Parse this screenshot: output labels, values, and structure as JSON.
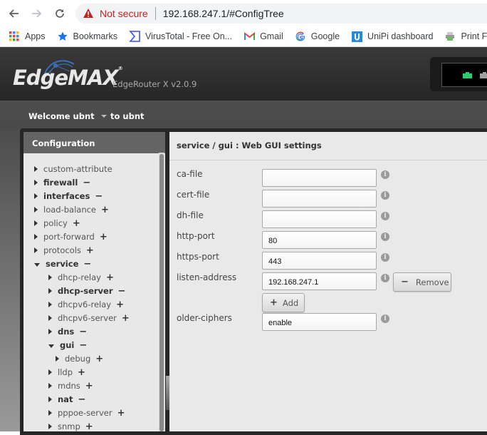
{
  "browser": {
    "not_secure_label": "Not secure",
    "url": "192.168.247.1/#ConfigTree",
    "bookmarks": [
      {
        "label": "Apps",
        "icon": "apps-grid-icon"
      },
      {
        "label": "Bookmarks",
        "icon": "star-icon"
      },
      {
        "label": "VirusTotal - Free On...",
        "icon": "virustotal-icon"
      },
      {
        "label": "Gmail",
        "icon": "gmail-icon"
      },
      {
        "label": "Google",
        "icon": "google-icon"
      },
      {
        "label": "UniPi dashboard",
        "icon": "unipi-icon"
      },
      {
        "label": "Print Frien",
        "icon": "printer-icon"
      }
    ]
  },
  "header": {
    "logo": "EdgeMAX",
    "logo_mark": "®",
    "model": "EdgeRouter X v2.0.9",
    "ports": [
      {
        "status": "active",
        "color": "#2ecc71"
      },
      {
        "status": "inactive",
        "color": "#a0a0a0"
      }
    ]
  },
  "subnav": {
    "welcome": "Welcome ubnt",
    "to_user": "to ubnt"
  },
  "tree": {
    "title": "Configuration",
    "items": [
      {
        "label": "custom-attribute",
        "level": 0,
        "expanded": false,
        "bold": false,
        "action": ""
      },
      {
        "label": "firewall",
        "level": 0,
        "expanded": false,
        "bold": true,
        "action": "−"
      },
      {
        "label": "interfaces",
        "level": 0,
        "expanded": false,
        "bold": true,
        "action": "−"
      },
      {
        "label": "load-balance",
        "level": 0,
        "expanded": false,
        "bold": false,
        "action": "+"
      },
      {
        "label": "policy",
        "level": 0,
        "expanded": false,
        "bold": false,
        "action": "+"
      },
      {
        "label": "port-forward",
        "level": 0,
        "expanded": false,
        "bold": false,
        "action": "+"
      },
      {
        "label": "protocols",
        "level": 0,
        "expanded": false,
        "bold": false,
        "action": "+"
      },
      {
        "label": "service",
        "level": 0,
        "expanded": true,
        "bold": true,
        "action": "−"
      },
      {
        "label": "dhcp-relay",
        "level": 1,
        "expanded": false,
        "bold": false,
        "action": "+"
      },
      {
        "label": "dhcp-server",
        "level": 1,
        "expanded": false,
        "bold": true,
        "action": "−"
      },
      {
        "label": "dhcpv6-relay",
        "level": 1,
        "expanded": false,
        "bold": false,
        "action": "+"
      },
      {
        "label": "dhcpv6-server",
        "level": 1,
        "expanded": false,
        "bold": false,
        "action": "+"
      },
      {
        "label": "dns",
        "level": 1,
        "expanded": false,
        "bold": true,
        "action": "−"
      },
      {
        "label": "gui",
        "level": 1,
        "expanded": true,
        "bold": true,
        "action": "−"
      },
      {
        "label": "debug",
        "level": 2,
        "expanded": false,
        "bold": false,
        "action": "+"
      },
      {
        "label": "lldp",
        "level": 1,
        "expanded": false,
        "bold": false,
        "action": "+"
      },
      {
        "label": "mdns",
        "level": 1,
        "expanded": false,
        "bold": false,
        "action": "+"
      },
      {
        "label": "nat",
        "level": 1,
        "expanded": false,
        "bold": true,
        "action": "−"
      },
      {
        "label": "pppoe-server",
        "level": 1,
        "expanded": false,
        "bold": false,
        "action": "+"
      },
      {
        "label": "snmp",
        "level": 1,
        "expanded": false,
        "bold": false,
        "action": "+"
      }
    ]
  },
  "content": {
    "title": "service / gui : Web GUI settings",
    "fields": [
      {
        "label": "ca-file",
        "value": ""
      },
      {
        "label": "cert-file",
        "value": ""
      },
      {
        "label": "dh-file",
        "value": ""
      },
      {
        "label": "http-port",
        "value": "80"
      },
      {
        "label": "https-port",
        "value": "443"
      },
      {
        "label": "listen-address",
        "value": "192.168.247.1"
      },
      {
        "label": "older-ciphers",
        "value": "enable"
      }
    ],
    "remove_label": "Remove",
    "remove_symbol": "−",
    "add_label": "Add",
    "add_symbol": "+",
    "info_symbol": "i"
  }
}
